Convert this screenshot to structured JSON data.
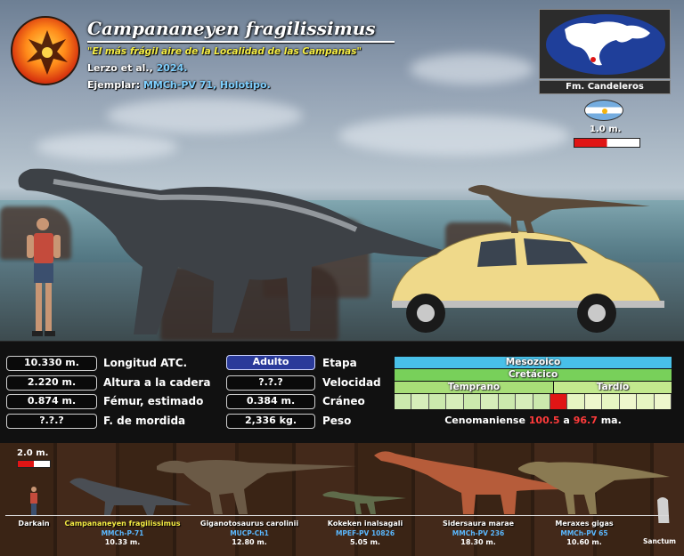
{
  "header": {
    "title": "Campananeyen fragilissimus",
    "subtitle": "\"El más frágil aire de la Localidad de las Campanas\"",
    "authors": "Lerzo et al.,",
    "year": "2024.",
    "specimen_label": "Ejemplar:",
    "specimen_number": "MMCh-PV 71, Holotipo."
  },
  "location": {
    "formation": "Fm. Candeleros",
    "flag_icon": "argentina-flag-icon",
    "scale_label": "1.0 m."
  },
  "stats": {
    "left": [
      {
        "value": "10.330 m.",
        "label": "Longitud ATC."
      },
      {
        "value": "2.220 m.",
        "label": "Altura a la cadera"
      },
      {
        "value": "0.874 m.",
        "label": "Fémur, estimado"
      },
      {
        "value": "?.?.?",
        "label": "F. de mordida"
      }
    ],
    "right": [
      {
        "value": "Adulto",
        "label": "Etapa"
      },
      {
        "value": "?.?.?",
        "label": "Velocidad"
      },
      {
        "value": "0.384 m.",
        "label": "Cráneo"
      },
      {
        "value": "2,336 kg.",
        "label": "Peso"
      }
    ]
  },
  "timeline": {
    "era": "Mesozoico",
    "period": "Cretácico",
    "early": "Temprano",
    "late": "Tardío",
    "stage": "Cenomaniense",
    "start": "100.5",
    "connector": "a",
    "end": "96.7",
    "unit": "ma.",
    "colors": {
      "era": "#48c0e8",
      "period": "#78d05a",
      "epoch": "#a8de78",
      "highlight": "#e01515"
    }
  },
  "lineup": {
    "scale_label": "2.0 m.",
    "species": [
      {
        "name": "Darkain",
        "specimen": "",
        "length": ""
      },
      {
        "name": "Campananeyen fragilissimus",
        "specimen": "MMCh-P-71",
        "length": "10.33 m."
      },
      {
        "name": "Giganotosaurus carolinii",
        "specimen": "MUCP-Ch1",
        "length": "12.80 m."
      },
      {
        "name": "Kokeken inalsagali",
        "specimen": "MPEF-PV 10826",
        "length": "5.05 m."
      },
      {
        "name": "Sidersaura marae",
        "specimen": "MMCh-PV 236",
        "length": "18.30 m."
      },
      {
        "name": "Meraxes gigas",
        "specimen": "MMCh-PV 65",
        "length": "10.60 m."
      }
    ],
    "logo_text": "Sanctum"
  }
}
